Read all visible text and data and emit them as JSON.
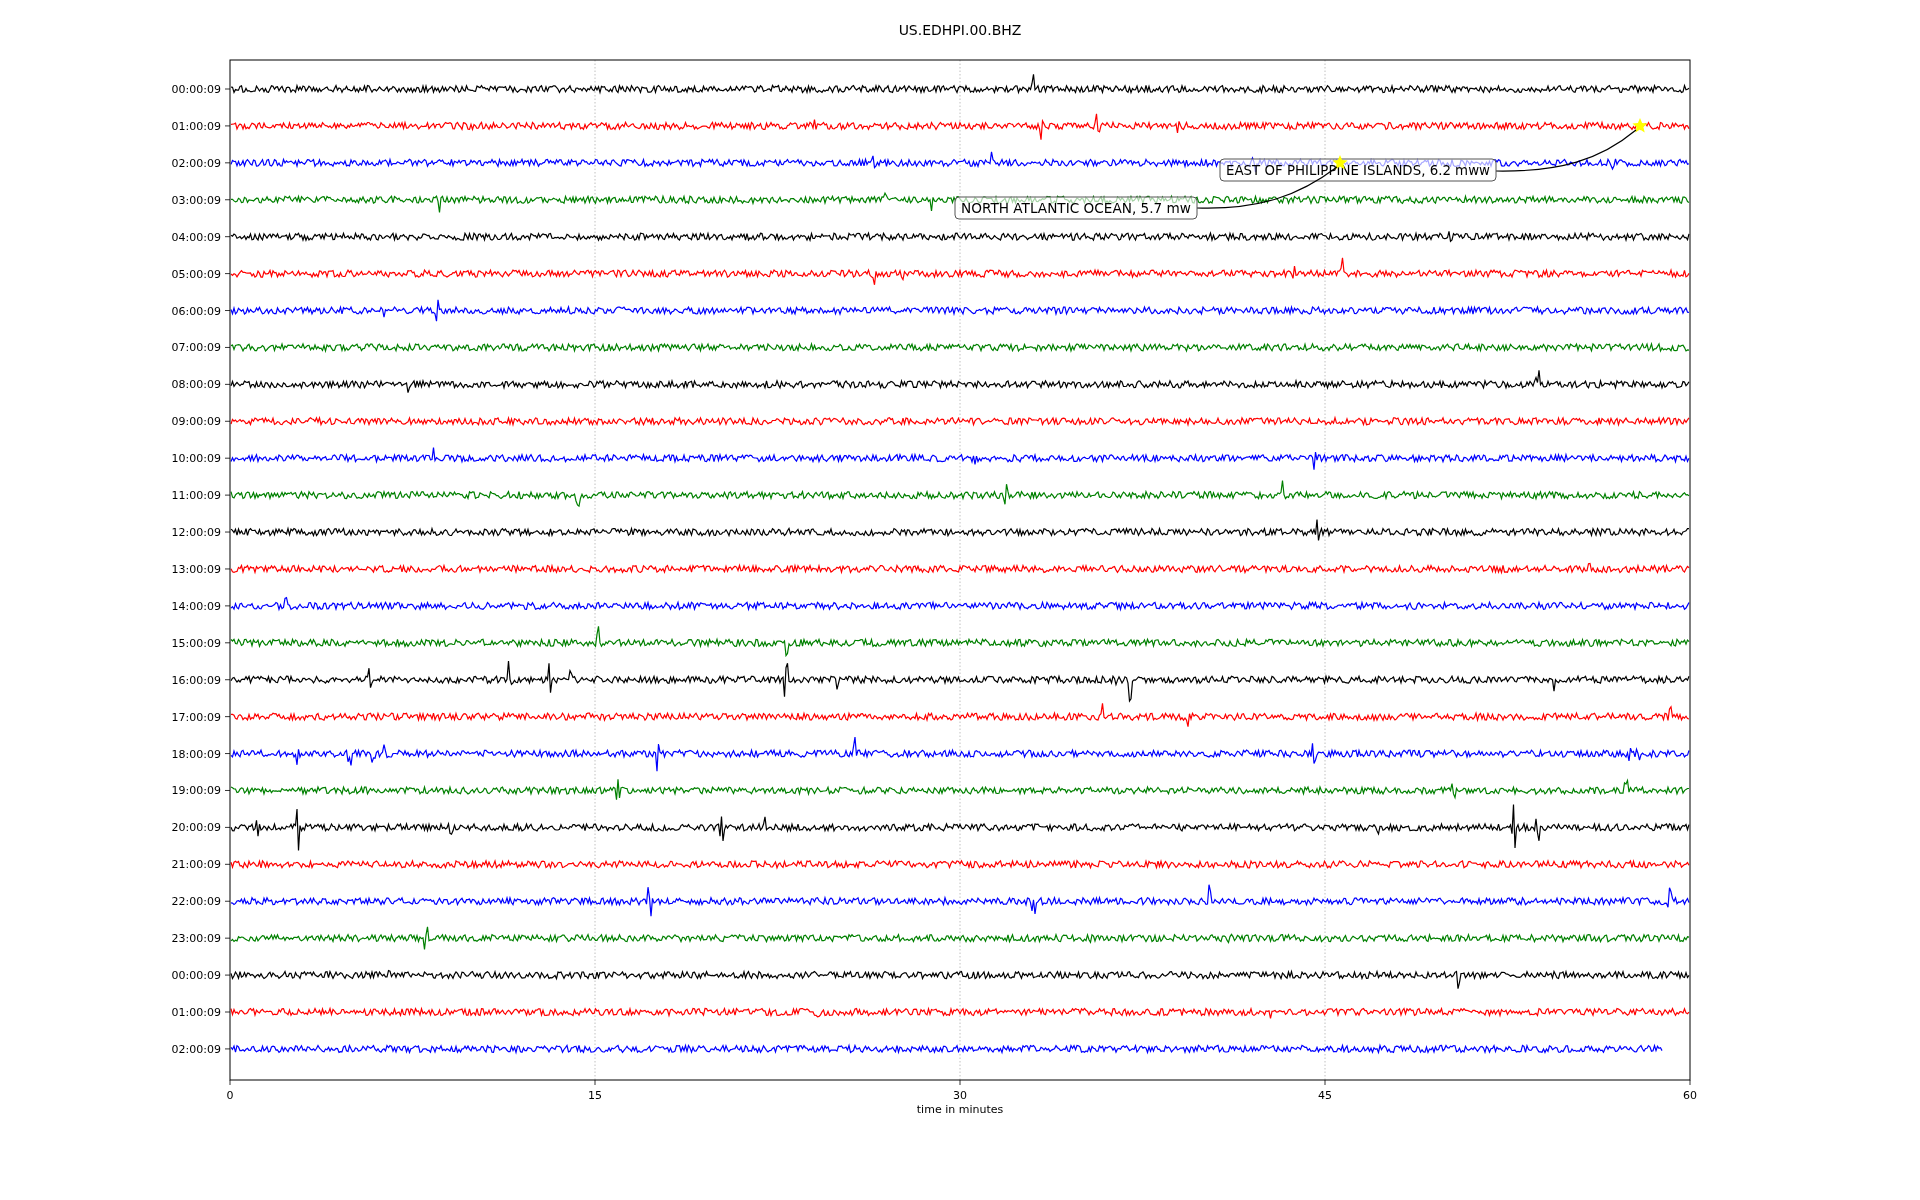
{
  "title": "US.EDHPI.00.BHZ",
  "rows": [
    {
      "time": "00:00:09",
      "color": "#000000"
    },
    {
      "time": "01:00:09",
      "color": "#ff0000"
    },
    {
      "time": "02:00:09",
      "color": "#0000ff"
    },
    {
      "time": "03:00:09",
      "color": "#008000"
    },
    {
      "time": "04:00:09",
      "color": "#000000"
    },
    {
      "time": "05:00:09",
      "color": "#ff0000"
    },
    {
      "time": "06:00:09",
      "color": "#0000ff"
    },
    {
      "time": "07:00:09",
      "color": "#008000"
    },
    {
      "time": "08:00:09",
      "color": "#000000"
    },
    {
      "time": "09:00:09",
      "color": "#ff0000"
    },
    {
      "time": "10:00:09",
      "color": "#0000ff"
    },
    {
      "time": "11:00:09",
      "color": "#008000"
    },
    {
      "time": "12:00:09",
      "color": "#000000"
    },
    {
      "time": "13:00:09",
      "color": "#ff0000"
    },
    {
      "time": "14:00:09",
      "color": "#0000ff"
    },
    {
      "time": "15:00:09",
      "color": "#008000"
    },
    {
      "time": "16:00:09",
      "color": "#000000"
    },
    {
      "time": "17:00:09",
      "color": "#ff0000"
    },
    {
      "time": "18:00:09",
      "color": "#0000ff"
    },
    {
      "time": "19:00:09",
      "color": "#008000"
    },
    {
      "time": "20:00:09",
      "color": "#000000"
    },
    {
      "time": "21:00:09",
      "color": "#ff0000"
    },
    {
      "time": "22:00:09",
      "color": "#0000ff"
    },
    {
      "time": "23:00:09",
      "color": "#008000"
    },
    {
      "time": "00:00:09",
      "color": "#000000"
    },
    {
      "time": "01:00:09",
      "color": "#ff0000"
    },
    {
      "time": "02:00:09",
      "color": "#0000ff"
    }
  ],
  "xticks": [
    "0",
    "15",
    "30",
    "45",
    "60"
  ],
  "xlabel": "time in minutes",
  "annotations": [
    {
      "text": "EAST OF PHILIPPINE ISLANDS, 6.2 mww"
    },
    {
      "text": "NORTH ATLANTIC OCEAN, 5.7 mw"
    }
  ]
}
